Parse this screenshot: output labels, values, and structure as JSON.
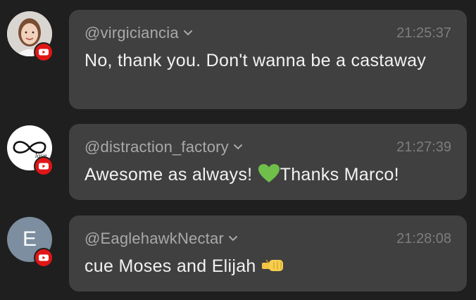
{
  "messages": [
    {
      "username": "@virgiciancia",
      "time": "21:25:37",
      "text": "No, thank you. Don't wanna be a castaway",
      "avatar": "photo",
      "platform_badge": "youtube-icon"
    },
    {
      "username": "@distraction_factory",
      "time": "21:27:39",
      "text_before": "Awesome as always! ",
      "text_after": "Thanks Marco!",
      "emoji": "green-heart-icon",
      "avatar": "infinity-love-logo",
      "avatar_text": "love",
      "platform_badge": "youtube-icon"
    },
    {
      "username": "@EaglehawkNectar",
      "time": "21:28:08",
      "text": "cue Moses and Elijah ",
      "emoji": "fist-bump-icon",
      "avatar": "letter",
      "avatar_letter": "E",
      "platform_badge": "youtube-icon"
    }
  ],
  "colors": {
    "background": "#1f1f1f",
    "bubble": "#404040",
    "username": "#a9a9a9",
    "time": "#7d7d7d",
    "message_text": "#f2f2f2",
    "youtube_red": "#e01616",
    "heart_green": "#6fbf4a",
    "letter_avatar": "#7c8ea0"
  }
}
